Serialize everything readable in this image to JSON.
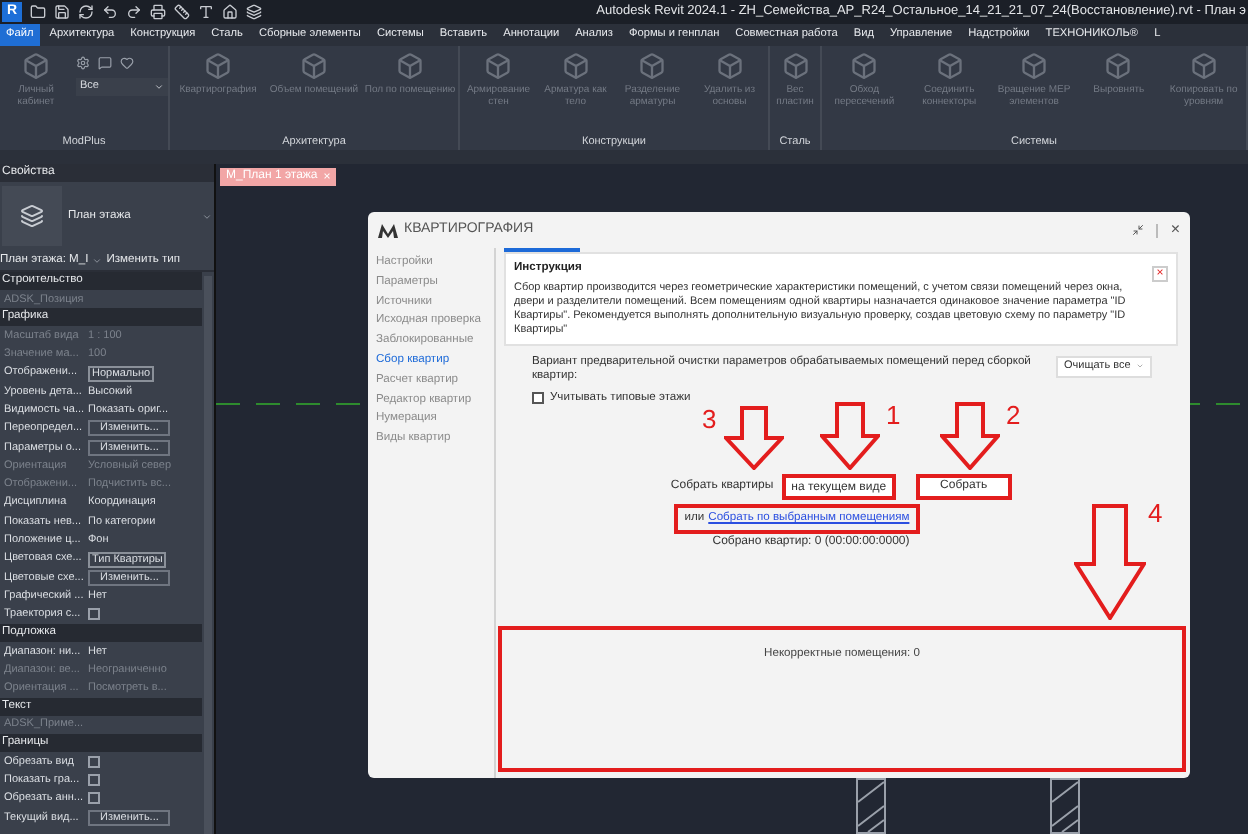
{
  "title_bar": {
    "logo": "R",
    "title": "Autodesk Revit 2024.1 - ZH_Семейства_АР_R24_Остальное_14_21_21_07_24(Восстановление).rvt - План э"
  },
  "menu": [
    {
      "label": "Файл",
      "selected": true
    },
    {
      "label": "Архитектура",
      "selected": false
    },
    {
      "label": "Конструкция",
      "selected": false
    },
    {
      "label": "Сталь",
      "selected": false
    },
    {
      "label": "Сборные элементы",
      "selected": false
    },
    {
      "label": "Системы",
      "selected": false
    },
    {
      "label": "Вставить",
      "selected": false
    },
    {
      "label": "Аннотации",
      "selected": false
    },
    {
      "label": "Анализ",
      "selected": false
    },
    {
      "label": "Формы и генплан",
      "selected": false
    },
    {
      "label": "Совместная работа",
      "selected": false
    },
    {
      "label": "Вид",
      "selected": false
    },
    {
      "label": "Управление",
      "selected": false
    },
    {
      "label": "Надстройки",
      "selected": false
    },
    {
      "label": "ТЕХНОНИКОЛЬ®",
      "selected": false
    },
    {
      "label": "L",
      "selected": false
    }
  ],
  "ribbon": [
    {
      "label": "ModPlus",
      "tools": [
        {
          "kind": "large",
          "label": "Личный кабинет"
        },
        {
          "kind": "combo",
          "value": "Все"
        }
      ]
    },
    {
      "label": "Архитектура",
      "tools": [
        {
          "kind": "large",
          "label": "Квартирография"
        },
        {
          "kind": "large",
          "label": "Объем помещений"
        },
        {
          "kind": "large",
          "label": "Пол по помещению"
        }
      ]
    },
    {
      "label": "Конструкции",
      "tools": [
        {
          "kind": "large",
          "label": "Армирование стен"
        },
        {
          "kind": "large",
          "label": "Арматура как тело"
        },
        {
          "kind": "large",
          "label": "Разделение арматуры"
        },
        {
          "kind": "large",
          "label": "Удалить из основы"
        }
      ]
    },
    {
      "label": "Сталь",
      "tools": [
        {
          "kind": "large",
          "label": "Вес пластин"
        }
      ]
    },
    {
      "label": "Системы",
      "tools": [
        {
          "kind": "large",
          "label": "Обход пересечений"
        },
        {
          "kind": "large",
          "label": "Соединить коннекторы"
        },
        {
          "kind": "large",
          "label": "Вращение MEP элементов"
        },
        {
          "kind": "large",
          "label": "Выровнять"
        },
        {
          "kind": "large",
          "label": "Копировать по уровням"
        }
      ]
    }
  ],
  "properties": {
    "title": "Свойства",
    "type_name": "План этажа",
    "view_selector": "План этажа: М_I",
    "edit_type": "Изменить тип",
    "sections": [
      {
        "title": "Строительство",
        "rows": [
          {
            "kind": "label",
            "label": "ADSK_Позиция",
            "disabled": true
          }
        ]
      },
      {
        "title": "Графика",
        "rows": [
          {
            "kind": "text",
            "label": "Масштаб вида",
            "value": "1 : 100",
            "disabled": true
          },
          {
            "kind": "text",
            "label": "Значение ма...",
            "value": "100",
            "disabled": true
          },
          {
            "kind": "field",
            "label": "Отображени...",
            "value": "Нормально",
            "disabled": false
          },
          {
            "kind": "text",
            "label": "Уровень дета...",
            "value": "Высокий",
            "disabled": false
          },
          {
            "kind": "text",
            "label": "Видимость ча...",
            "value": "Показать ориг...",
            "disabled": false
          },
          {
            "kind": "button",
            "label": "Переопредел...",
            "value": "Изменить...",
            "disabled": false
          },
          {
            "kind": "button",
            "label": "Параметры о...",
            "value": "Изменить...",
            "disabled": false
          },
          {
            "kind": "text",
            "label": "Ориентация",
            "value": "Условный север",
            "disabled": true
          },
          {
            "kind": "text",
            "label": "Отображени...",
            "value": "Подчистить вс...",
            "disabled": true
          },
          {
            "kind": "text",
            "label": "Дисциплина",
            "value": "Координация",
            "disabled": false
          },
          {
            "kind": "text",
            "label": "Показать нев...",
            "value": "По категории",
            "disabled": false
          },
          {
            "kind": "text",
            "label": "Положение ц...",
            "value": "Фон",
            "disabled": false
          },
          {
            "kind": "field",
            "label": "Цветовая схе...",
            "value": "Тип Квартиры",
            "disabled": false
          },
          {
            "kind": "button",
            "label": "Цветовые схе...",
            "value": "Изменить...",
            "disabled": false
          },
          {
            "kind": "text",
            "label": "Графический ...",
            "value": "Нет",
            "disabled": false
          },
          {
            "kind": "checkbox",
            "label": "Траектория с...",
            "checked": false,
            "disabled": false
          }
        ]
      },
      {
        "title": "Подложка",
        "rows": [
          {
            "kind": "text",
            "label": "Диапазон: ни...",
            "value": "Нет",
            "disabled": false
          },
          {
            "kind": "text",
            "label": "Диапазон: ве...",
            "value": "Неограниченно",
            "disabled": true
          },
          {
            "kind": "text",
            "label": "Ориентация ...",
            "value": "Посмотреть в...",
            "disabled": true
          }
        ]
      },
      {
        "title": "Текст",
        "rows": [
          {
            "kind": "label",
            "label": "ADSK_Приме...",
            "disabled": true
          }
        ]
      },
      {
        "title": "Границы",
        "rows": [
          {
            "kind": "checkbox",
            "label": "Обрезать вид",
            "checked": false,
            "disabled": false
          },
          {
            "kind": "checkbox",
            "label": "Показать гра...",
            "checked": false,
            "disabled": false
          },
          {
            "kind": "checkbox",
            "label": "Обрезать анн...",
            "checked": false,
            "disabled": false
          },
          {
            "kind": "button",
            "label": "Текущий вид...",
            "value": "Изменить...",
            "disabled": false
          }
        ]
      }
    ]
  },
  "view_tab": {
    "label": "М_План 1 этажа",
    "close": "×"
  },
  "dialog": {
    "title": "КВАРТИРОГРАФИЯ",
    "close": "×",
    "nav": [
      {
        "label": "Настройки",
        "selected": false
      },
      {
        "label": "Параметры",
        "selected": false
      },
      {
        "label": "Источники",
        "selected": false
      },
      {
        "label": "Исходная проверка",
        "selected": false
      },
      {
        "label": "Заблокированные",
        "selected": false
      },
      {
        "label": "Сбор квартир",
        "selected": true
      },
      {
        "label": "Расчет квартир",
        "selected": false
      },
      {
        "label": "Редактор квартир",
        "selected": false
      },
      {
        "label": "Нумерация",
        "selected": false
      },
      {
        "label": "Виды квартир",
        "selected": false
      }
    ],
    "instruction": {
      "title": "Инструкция",
      "close": "×",
      "text": "Сбор квартир производится через геометрические характеристики помещений, с учетом связи помещений через окна, двери и разделители помещений. Всем помещениям одной квартиры назначается одинаковое значение параметра \"ID Квартиры\". Рекомендуется выполнять дополнительную визуальную проверку, создав цветовую схему по параметру \"ID Квартиры\""
    },
    "cleanup": {
      "label": "Вариант предварительной очистки параметров обрабатываемых помещений перед сборкой квартир:",
      "value": "Очищать все"
    },
    "typical_floors": {
      "label": "Учитывать типовые этажи",
      "checked": false
    },
    "collect": {
      "label": "Собрать квартиры",
      "mode": {
        "value": "на текущем виде",
        "highlighted": true
      },
      "button": {
        "label": "Собрать",
        "highlighted": true
      }
    },
    "alt": {
      "prefix": "или",
      "link": "Собрать по выбранным помещениям",
      "highlighted": true
    },
    "result": "Собрано квартир: 0 (00:00:00:0000)",
    "incorrect": {
      "text": "Некорректные помещения: 0",
      "highlighted": true
    }
  },
  "annotations": [
    {
      "label": "3"
    },
    {
      "label": "1"
    },
    {
      "label": "2"
    },
    {
      "label": "4"
    }
  ]
}
